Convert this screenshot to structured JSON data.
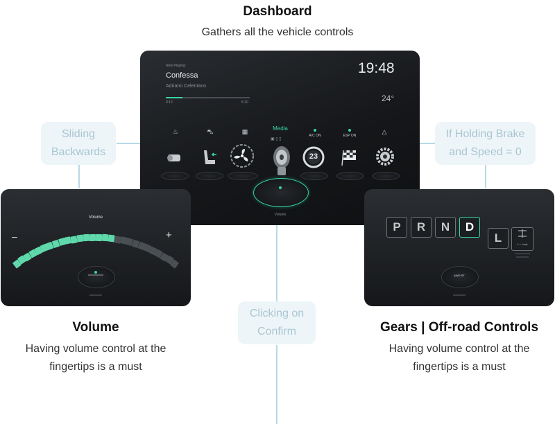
{
  "dashboard": {
    "title": "Dashboard",
    "subtitle": "Gathers all the vehicle controls",
    "now_playing_label": "Now Playing:",
    "song": "Confessa",
    "artist": "Adriano Celentano",
    "time_elapsed": "0:12",
    "time_total": "5:10",
    "progress": 0.2,
    "clock": "19:48",
    "temperature": "24°",
    "media_label": "Media",
    "ac_label": "A/C ON",
    "esp_label": "ESP ON",
    "fan_speed": "23",
    "knob_caption": "Volume"
  },
  "annotations": {
    "left": "Sliding Backwards",
    "right": "If Holding Brake and Speed = 0",
    "bottom": "Clicking on Confirm"
  },
  "volume": {
    "screen_title": "Volume",
    "minus": "–",
    "plus": "+",
    "level": 0.6,
    "title": "Volume",
    "subtitle_line1": "Having volume control at the",
    "subtitle_line2": "fingertips is a must"
  },
  "gears": {
    "letters": [
      "P",
      "R",
      "N",
      "D",
      "L"
    ],
    "selected": "D",
    "lock_label": "L + Lock",
    "knob_text": "AWD ST",
    "title": "Gears | Off-road Controls",
    "subtitle_line1": "Having volume control at the",
    "subtitle_line2": "fingertips is a must"
  },
  "colors": {
    "accent": "#38d6a0",
    "connector": "#b9d8e4",
    "pill_bg": "#eef5f8",
    "pill_text": "#a8c6d2"
  }
}
